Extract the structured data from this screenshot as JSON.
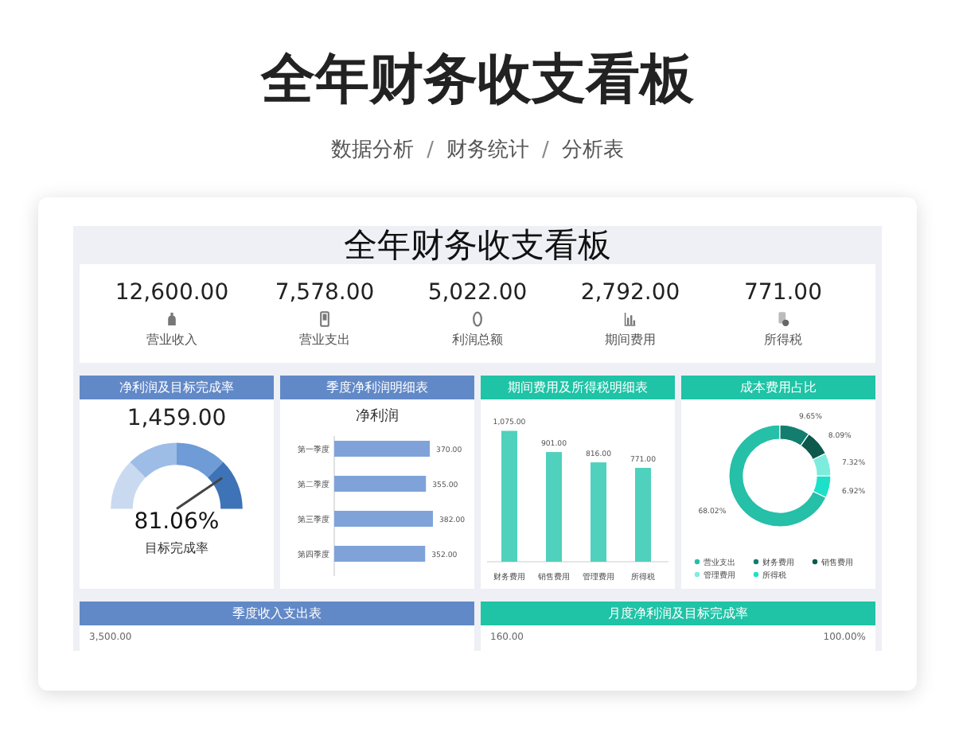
{
  "page": {
    "title": "全年财务收支看板",
    "breadcrumb": [
      "数据分析",
      "财务统计",
      "分析表"
    ],
    "separator": "/"
  },
  "dashboard": {
    "title": "全年财务收支看板",
    "kpis": [
      {
        "value": "12,600.00",
        "label": "营业收入"
      },
      {
        "value": "7,578.00",
        "label": "营业支出"
      },
      {
        "value": "5,022.00",
        "label": "利润总额"
      },
      {
        "value": "2,792.00",
        "label": "期间费用"
      },
      {
        "value": "771.00",
        "label": "所得税"
      }
    ],
    "gauge_panel": {
      "header": "净利润及目标完成率",
      "value": "1,459.00",
      "level": 0.8106,
      "percent": "81.06%",
      "label": "目标完成率"
    },
    "quarter_panel": {
      "header": "季度净利润明细表",
      "chart_data": {
        "type": "bar",
        "orientation": "horizontal",
        "title": "净利润",
        "categories": [
          "第一季度",
          "第二季度",
          "第三季度",
          "第四季度"
        ],
        "values": [
          370,
          355,
          382,
          352
        ],
        "value_labels": [
          "370.00",
          "355.00",
          "382.00",
          "352.00"
        ]
      }
    },
    "expense_panel": {
      "header": "期间费用及所得税明细表",
      "chart_data": {
        "type": "bar",
        "categories": [
          "财务费用",
          "销售费用",
          "管理费用",
          "所得税"
        ],
        "values": [
          1075,
          901,
          816,
          771
        ],
        "value_labels": [
          "1,075.00",
          "901.00",
          "816.00",
          "771.00"
        ]
      }
    },
    "cost_panel": {
      "header": "成本费用占比",
      "chart_data": {
        "type": "donut",
        "categories": [
          "营业支出",
          "财务费用",
          "销售费用",
          "管理费用",
          "所得税"
        ],
        "values": [
          68.02,
          9.65,
          8.09,
          7.32,
          6.92
        ],
        "legend": true,
        "colors": [
          "#26bfa8",
          "#137e6e",
          "#0b5a4c",
          "#7eecdc",
          "#1de0c8"
        ],
        "value_labels": [
          "68.02%",
          "9.65%",
          "8.09%",
          "7.32%",
          "6.92%"
        ]
      }
    },
    "bottom_panels": [
      {
        "header": "季度收入支出表",
        "kind": "blue",
        "ticks": [
          "3,500.00"
        ]
      },
      {
        "header": "月度净利润及目标完成率",
        "kind": "teal",
        "ticks": [
          "160.00",
          "100.00%"
        ]
      }
    ]
  }
}
